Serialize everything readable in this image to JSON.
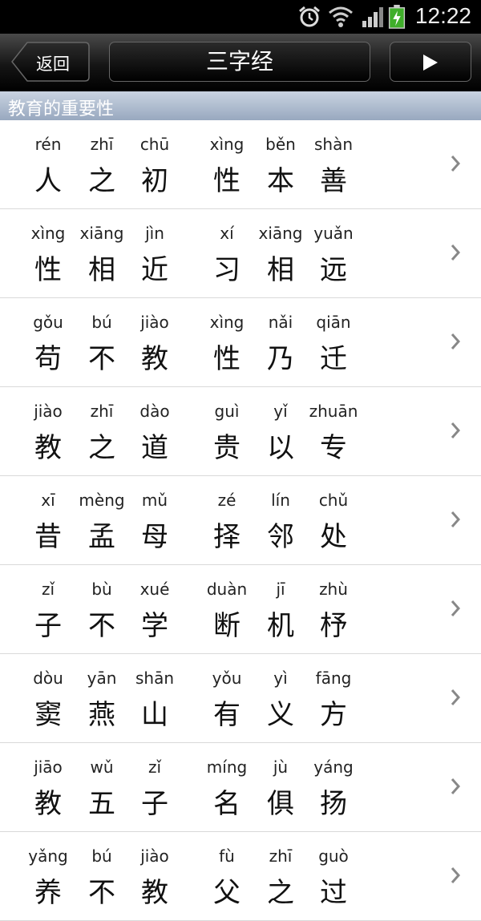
{
  "status_bar": {
    "time": "12:22",
    "icons": [
      "alarm-icon",
      "wifi-icon",
      "signal-icon",
      "battery-charging-icon"
    ]
  },
  "nav": {
    "back_label": "返回",
    "title": "三字经",
    "play_icon": "play-icon"
  },
  "section": {
    "title": "教育的重要性"
  },
  "rows": [
    [
      [
        "rén",
        "人"
      ],
      [
        "zhī",
        "之"
      ],
      [
        "chū",
        "初"
      ],
      [
        "xìng",
        "性"
      ],
      [
        "běn",
        "本"
      ],
      [
        "shàn",
        "善"
      ]
    ],
    [
      [
        "xìng",
        "性"
      ],
      [
        "xiāng",
        "相"
      ],
      [
        "jìn",
        "近"
      ],
      [
        "xí",
        "习"
      ],
      [
        "xiāng",
        "相"
      ],
      [
        "yuǎn",
        "远"
      ]
    ],
    [
      [
        "gǒu",
        "苟"
      ],
      [
        "bú",
        "不"
      ],
      [
        "jiào",
        "教"
      ],
      [
        "xìng",
        "性"
      ],
      [
        "nǎi",
        "乃"
      ],
      [
        "qiān",
        "迁"
      ]
    ],
    [
      [
        "jiào",
        "教"
      ],
      [
        "zhī",
        "之"
      ],
      [
        "dào",
        "道"
      ],
      [
        "guì",
        "贵"
      ],
      [
        "yǐ",
        "以"
      ],
      [
        "zhuān",
        "专"
      ]
    ],
    [
      [
        "xī",
        "昔"
      ],
      [
        "mèng",
        "孟"
      ],
      [
        "mǔ",
        "母"
      ],
      [
        "zé",
        "择"
      ],
      [
        "lín",
        "邻"
      ],
      [
        "chǔ",
        "处"
      ]
    ],
    [
      [
        "zǐ",
        "子"
      ],
      [
        "bù",
        "不"
      ],
      [
        "xué",
        "学"
      ],
      [
        "duàn",
        "断"
      ],
      [
        "jī",
        "机"
      ],
      [
        "zhù",
        "杼"
      ]
    ],
    [
      [
        "dòu",
        "窦"
      ],
      [
        "yān",
        "燕"
      ],
      [
        "shān",
        "山"
      ],
      [
        "yǒu",
        "有"
      ],
      [
        "yì",
        "义"
      ],
      [
        "fāng",
        "方"
      ]
    ],
    [
      [
        "jiāo",
        "教"
      ],
      [
        "wǔ",
        "五"
      ],
      [
        "zǐ",
        "子"
      ],
      [
        "míng",
        "名"
      ],
      [
        "jù",
        "俱"
      ],
      [
        "yáng",
        "扬"
      ]
    ],
    [
      [
        "yǎng",
        "养"
      ],
      [
        "bú",
        "不"
      ],
      [
        "jiào",
        "教"
      ],
      [
        "fù",
        "父"
      ],
      [
        "zhī",
        "之"
      ],
      [
        "guò",
        "过"
      ]
    ]
  ]
}
